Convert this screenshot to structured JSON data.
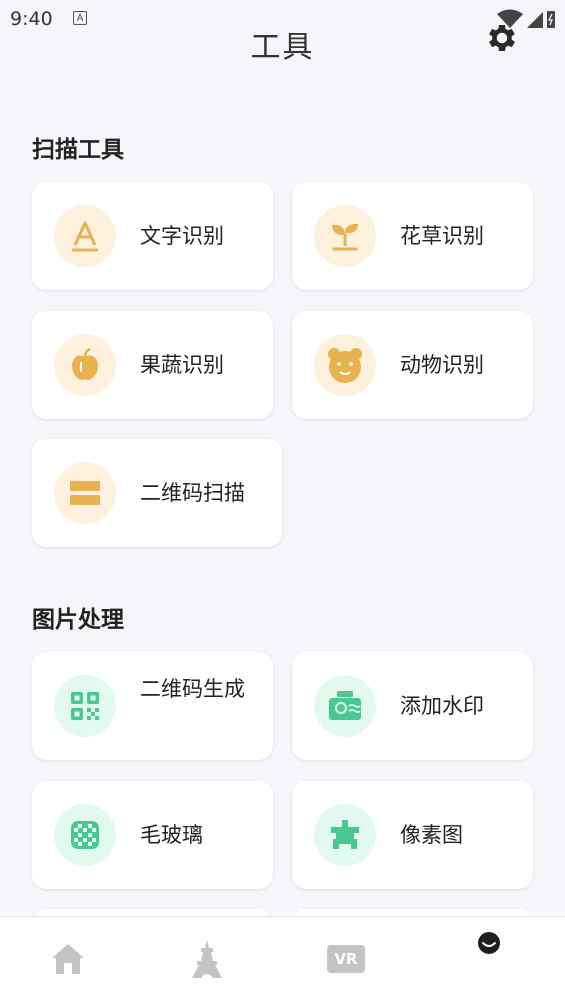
{
  "status": {
    "time": "9:40",
    "indicator": "A"
  },
  "header": {
    "title": "工具"
  },
  "sections": [
    {
      "title": "扫描工具",
      "items": [
        {
          "label": "文字识别",
          "icon": "text-recognition-icon"
        },
        {
          "label": "花草识别",
          "icon": "sprout-icon"
        },
        {
          "label": "果蔬识别",
          "icon": "apple-icon"
        },
        {
          "label": "动物识别",
          "icon": "bear-icon"
        },
        {
          "label": "二维码扫描",
          "icon": "scan-icon"
        }
      ]
    },
    {
      "title": "图片处理",
      "items": [
        {
          "label": "二维码生成",
          "icon": "qr-code-icon"
        },
        {
          "label": "添加水印",
          "icon": "watermark-icon"
        },
        {
          "label": "毛玻璃",
          "icon": "frosted-glass-icon"
        },
        {
          "label": "像素图",
          "icon": "pixel-star-icon"
        }
      ]
    }
  ],
  "tabbar": {
    "vr_label": "VR",
    "tabs": [
      "home-icon",
      "tower-icon",
      "vr-icon",
      "smile-icon"
    ]
  },
  "colors": {
    "warm": "#e7b24f",
    "warm_bg": "#fdf0dc",
    "mint": "#48c991",
    "mint_bg": "#e2f9ef"
  }
}
